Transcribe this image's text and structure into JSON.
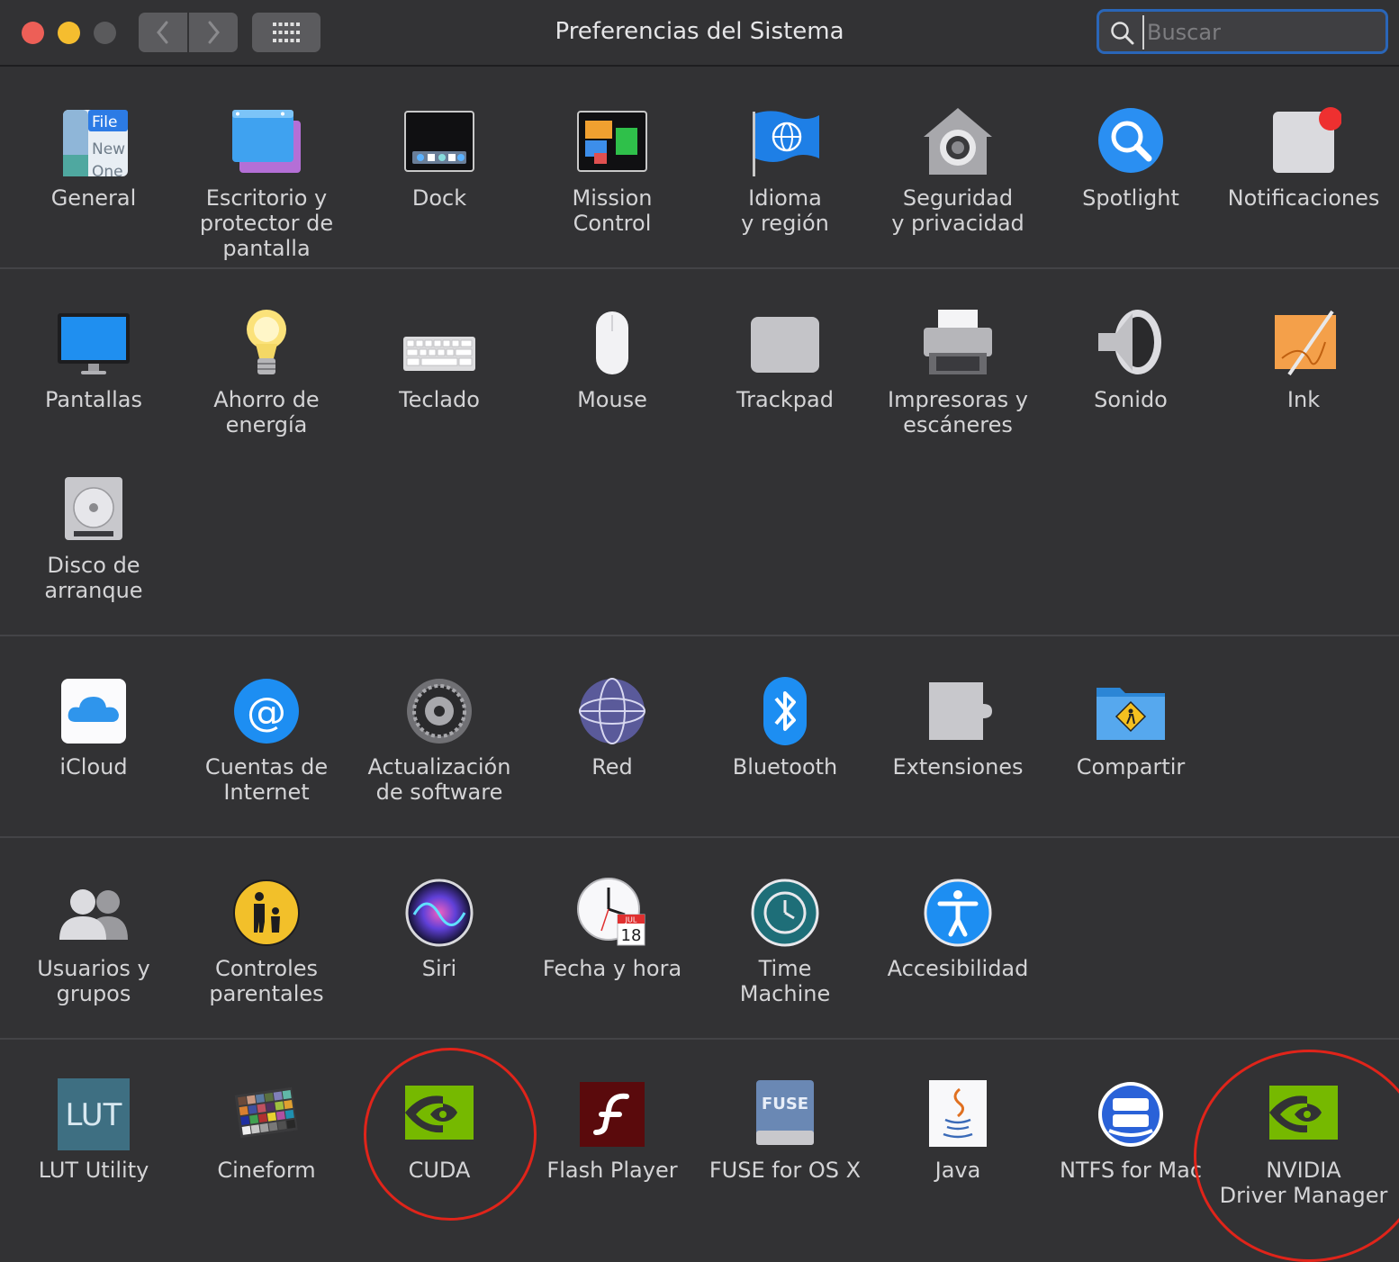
{
  "window": {
    "title": "Preferencias del Sistema",
    "search_placeholder": "Buscar"
  },
  "sections": [
    {
      "items": [
        {
          "label": "General",
          "icon": "general-icon"
        },
        {
          "label": "Escritorio y\nprotector de pantalla",
          "icon": "desktop-screensaver-icon"
        },
        {
          "label": "Dock",
          "icon": "dock-icon"
        },
        {
          "label": "Mission\nControl",
          "icon": "mission-control-icon"
        },
        {
          "label": "Idioma\ny región",
          "icon": "language-region-icon"
        },
        {
          "label": "Seguridad\ny privacidad",
          "icon": "security-privacy-icon"
        },
        {
          "label": "Spotlight",
          "icon": "spotlight-icon"
        },
        {
          "label": "Notificaciones",
          "icon": "notifications-icon"
        }
      ]
    },
    {
      "items": [
        {
          "label": "Pantallas",
          "icon": "displays-icon"
        },
        {
          "label": "Ahorro de\nenergía",
          "icon": "energy-saver-icon"
        },
        {
          "label": "Teclado",
          "icon": "keyboard-icon"
        },
        {
          "label": "Mouse",
          "icon": "mouse-icon"
        },
        {
          "label": "Trackpad",
          "icon": "trackpad-icon"
        },
        {
          "label": "Impresoras y\nescáneres",
          "icon": "printers-scanners-icon"
        },
        {
          "label": "Sonido",
          "icon": "sound-icon"
        },
        {
          "label": "Ink",
          "icon": "ink-icon"
        },
        {
          "label": "Disco de\narranque",
          "icon": "startup-disk-icon"
        }
      ]
    },
    {
      "items": [
        {
          "label": "iCloud",
          "icon": "icloud-icon"
        },
        {
          "label": "Cuentas de\nInternet",
          "icon": "internet-accounts-icon"
        },
        {
          "label": "Actualización\nde software",
          "icon": "software-update-icon"
        },
        {
          "label": "Red",
          "icon": "network-icon"
        },
        {
          "label": "Bluetooth",
          "icon": "bluetooth-icon"
        },
        {
          "label": "Extensiones",
          "icon": "extensions-icon"
        },
        {
          "label": "Compartir",
          "icon": "sharing-icon"
        }
      ]
    },
    {
      "items": [
        {
          "label": "Usuarios y\ngrupos",
          "icon": "users-groups-icon"
        },
        {
          "label": "Controles\nparentales",
          "icon": "parental-controls-icon"
        },
        {
          "label": "Siri",
          "icon": "siri-icon"
        },
        {
          "label": "Fecha y hora",
          "icon": "date-time-icon"
        },
        {
          "label": "Time\nMachine",
          "icon": "time-machine-icon"
        },
        {
          "label": "Accesibilidad",
          "icon": "accessibility-icon"
        }
      ]
    },
    {
      "items": [
        {
          "label": "LUT Utility",
          "icon": "lut-utility-icon",
          "icon_text": "LUT"
        },
        {
          "label": "Cineform",
          "icon": "cineform-icon"
        },
        {
          "label": "CUDA",
          "icon": "nvidia-cuda-icon"
        },
        {
          "label": "Flash Player",
          "icon": "flash-player-icon"
        },
        {
          "label": "FUSE for OS X",
          "icon": "fuse-icon",
          "icon_text": "FUSE"
        },
        {
          "label": "Java",
          "icon": "java-icon"
        },
        {
          "label": "NTFS for Mac",
          "icon": "ntfs-icon"
        },
        {
          "label": "NVIDIA\nDriver Manager",
          "icon": "nvidia-driver-manager-icon"
        }
      ]
    }
  ],
  "calendar_badge": {
    "month": "JUL",
    "day": "18"
  },
  "colors": {
    "background": "#323234",
    "accent_highlight": "#e0241a",
    "search_border": "#2a66b8",
    "nvidia_green": "#76b900"
  }
}
